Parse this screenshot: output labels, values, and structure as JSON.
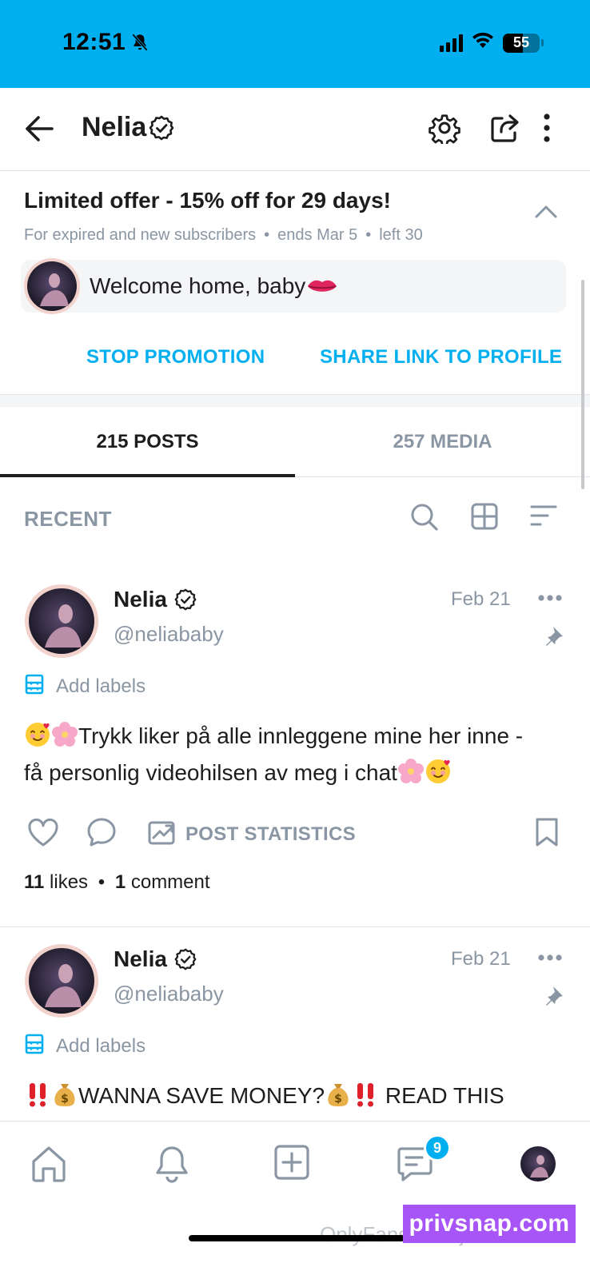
{
  "status_bar": {
    "time": "12:51",
    "battery": "55",
    "background": "#00aff0"
  },
  "header": {
    "title": "Nelia",
    "icons": [
      "back-arrow-icon",
      "verified-icon",
      "gear-icon",
      "share-icon",
      "more-vertical-icon"
    ]
  },
  "promo": {
    "title": "Limited offer - 15% off for 29 days!",
    "subtitle_audience": "For expired and new subscribers",
    "subtitle_ends": "ends Mar 5",
    "subtitle_left": "left 30",
    "message": "Welcome home, baby",
    "stop_label": "STOP PROMOTION",
    "share_label": "SHARE LINK TO PROFILE",
    "accent": "#00aff0"
  },
  "tabs": {
    "posts": "215 POSTS",
    "media": "257 MEDIA",
    "active": "posts"
  },
  "filter": {
    "label": "RECENT"
  },
  "posts": [
    {
      "name": "Nelia",
      "handle": "@neliababy",
      "date": "Feb 21",
      "labels": "Add labels",
      "text_line1": "Trykk liker på alle innleggene mine her inne -",
      "text_line2": "få personlig videohilsen av meg i chat",
      "stats_label": "POST STATISTICS",
      "likes_count": "11",
      "likes_word": "likes",
      "comments_count": "1",
      "comments_word": "comment"
    },
    {
      "name": "Nelia",
      "handle": "@neliababy",
      "date": "Feb 21",
      "labels": "Add labels",
      "text": "WANNA SAVE MONEY?",
      "text_tail": "READ THIS"
    }
  ],
  "bottom_nav": {
    "messages_badge": "9"
  },
  "watermark": {
    "site": "OnlyFans.com/justnelia",
    "brand": "privsnap.com"
  }
}
